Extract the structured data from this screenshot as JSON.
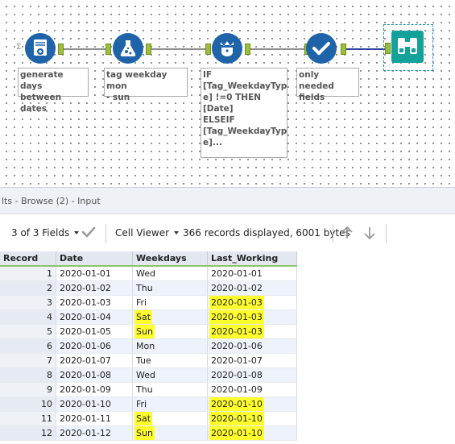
{
  "workflow": {
    "annotations": [
      "generate days\nbetween dates",
      "tag weekday mon\n- sun",
      "IF\n[Tag_WeekdayTyp\ne] !=0 THEN\n[Date]\nELSEIF\n[Tag_WeekdayTyp\ne]...",
      "only needed\nfields"
    ],
    "tools": [
      "generate-rows-tool",
      "formula-tool",
      "multi-row-formula-tool",
      "select-tool",
      "browse-tool"
    ]
  },
  "results": {
    "title": "lts - Browse (2) - Input",
    "fields_label": "3 of 3 Fields",
    "viewer_label": "Cell Viewer",
    "status": "366 records displayed, 6001 bytes",
    "columns": [
      "Record",
      "Date",
      "Weekdays",
      "Last_Working"
    ],
    "rows": [
      {
        "record": "1",
        "date": "2020-01-01",
        "weekday": "Wed",
        "last": "2020-01-01",
        "hw": false,
        "hl": false
      },
      {
        "record": "2",
        "date": "2020-01-02",
        "weekday": "Thu",
        "last": "2020-01-02",
        "hw": false,
        "hl": false
      },
      {
        "record": "3",
        "date": "2020-01-03",
        "weekday": "Fri",
        "last": "2020-01-03",
        "hw": false,
        "hl": true
      },
      {
        "record": "4",
        "date": "2020-01-04",
        "weekday": "Sat",
        "last": "2020-01-03",
        "hw": true,
        "hl": true
      },
      {
        "record": "5",
        "date": "2020-01-05",
        "weekday": "Sun",
        "last": "2020-01-03",
        "hw": true,
        "hl": true
      },
      {
        "record": "6",
        "date": "2020-01-06",
        "weekday": "Mon",
        "last": "2020-01-06",
        "hw": false,
        "hl": false
      },
      {
        "record": "7",
        "date": "2020-01-07",
        "weekday": "Tue",
        "last": "2020-01-07",
        "hw": false,
        "hl": false
      },
      {
        "record": "8",
        "date": "2020-01-08",
        "weekday": "Wed",
        "last": "2020-01-08",
        "hw": false,
        "hl": false
      },
      {
        "record": "9",
        "date": "2020-01-09",
        "weekday": "Thu",
        "last": "2020-01-09",
        "hw": false,
        "hl": false
      },
      {
        "record": "10",
        "date": "2020-01-10",
        "weekday": "Fri",
        "last": "2020-01-10",
        "hw": false,
        "hl": true
      },
      {
        "record": "11",
        "date": "2020-01-11",
        "weekday": "Sat",
        "last": "2020-01-10",
        "hw": true,
        "hl": true
      },
      {
        "record": "12",
        "date": "2020-01-12",
        "weekday": "Sun",
        "last": "2020-01-10",
        "hw": true,
        "hl": true
      }
    ]
  }
}
